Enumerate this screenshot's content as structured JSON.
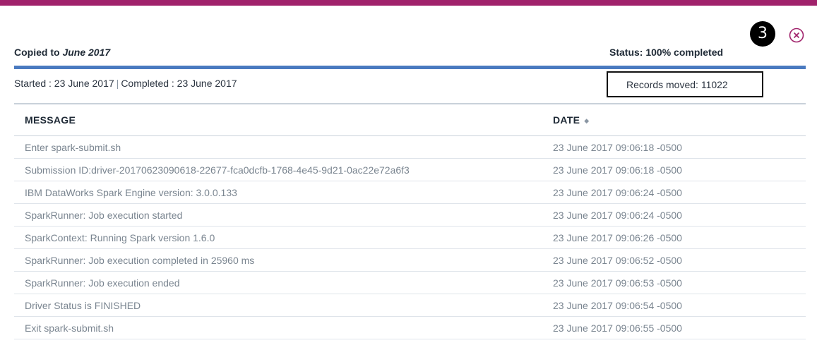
{
  "header": {
    "copied_prefix": "Copied to",
    "copied_target": "June 2017",
    "status": "Status: 100% completed",
    "progress_percent": 100,
    "step_badge": "3",
    "close_icon": "close-circle-icon"
  },
  "info": {
    "started": "Started : 23 June 2017",
    "separator": "|",
    "completed": "Completed : 23 June 2017",
    "records": "Records moved: 11022"
  },
  "table": {
    "columns": [
      "MESSAGE",
      "DATE"
    ],
    "sort_icon": "sort-icon",
    "rows": [
      {
        "message": "Enter spark-submit.sh",
        "date": "23 June 2017 09:06:18 -0500"
      },
      {
        "message": "Submission ID:driver-20170623090618-22677-fca0dcfb-1768-4e45-9d21-0ac22e72a6f3",
        "date": "23 June 2017 09:06:18 -0500"
      },
      {
        "message": "IBM DataWorks Spark Engine version: 3.0.0.133",
        "date": "23 June 2017 09:06:24 -0500"
      },
      {
        "message": "SparkRunner: Job execution started",
        "date": "23 June 2017 09:06:24 -0500"
      },
      {
        "message": "SparkContext: Running Spark version 1.6.0",
        "date": "23 June 2017 09:06:26 -0500"
      },
      {
        "message": "SparkRunner: Job execution completed in 25960 ms",
        "date": "23 June 2017 09:06:52 -0500"
      },
      {
        "message": "SparkRunner: Job execution ended",
        "date": "23 June 2017 09:06:53 -0500"
      },
      {
        "message": "Driver Status is FINISHED",
        "date": "23 June 2017 09:06:54 -0500"
      },
      {
        "message": "Exit spark-submit.sh",
        "date": "23 June 2017 09:06:55 -0500"
      }
    ]
  },
  "colors": {
    "top_bar": "#a0226b",
    "progress": "#4a7ac0",
    "close_icon": "#a0226b"
  }
}
